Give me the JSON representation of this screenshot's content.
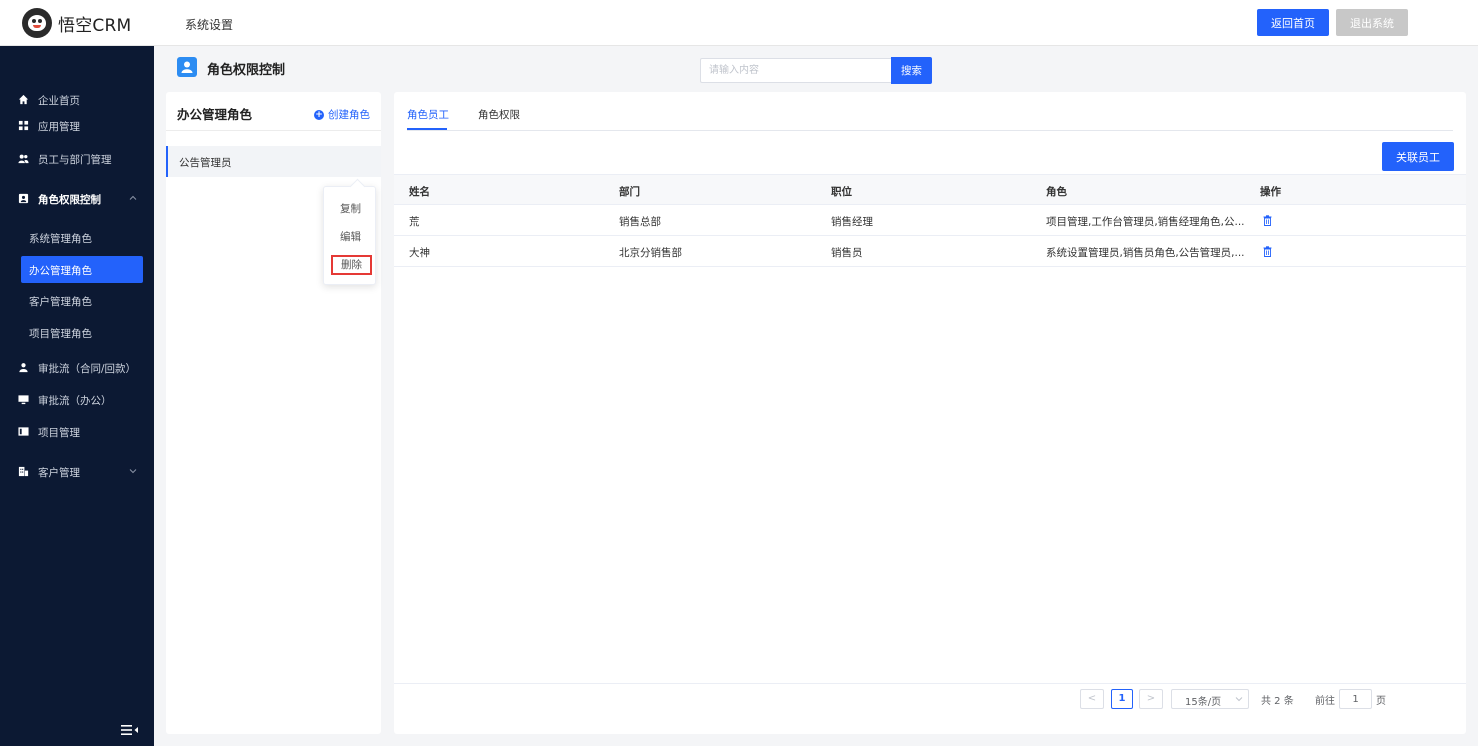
{
  "app": {
    "logo_text": "悟空CRM",
    "section_title": "系统设置"
  },
  "header": {
    "home_label": "返回首页",
    "exit_label": "退出系统"
  },
  "sidebar": {
    "items": [
      {
        "label": "企业首页",
        "icon": "home-icon"
      },
      {
        "label": "应用管理",
        "icon": "apps-icon"
      },
      {
        "label": "员工与部门管理",
        "icon": "users-icon"
      },
      {
        "label": "角色权限控制",
        "icon": "role-icon",
        "expanded": true
      },
      {
        "label": "审批流（合同/回款）",
        "icon": "approval-icon"
      },
      {
        "label": "审批流（办公）",
        "icon": "monitor-icon"
      },
      {
        "label": "项目管理",
        "icon": "project-icon"
      },
      {
        "label": "客户管理",
        "icon": "customer-icon",
        "expandable": true
      }
    ],
    "sub_items": [
      {
        "label": "系统管理角色",
        "active": false
      },
      {
        "label": "办公管理角色",
        "active": true
      },
      {
        "label": "客户管理角色",
        "active": false
      },
      {
        "label": "项目管理角色",
        "active": false
      }
    ]
  },
  "page": {
    "title": "角色权限控制"
  },
  "search": {
    "placeholder": "请输入内容",
    "value": "",
    "button_label": "搜索"
  },
  "role_panel": {
    "title": "办公管理角色",
    "create_label": "创建角色",
    "roles": [
      {
        "label": "公告管理员"
      }
    ]
  },
  "popover": {
    "copy": "复制",
    "edit": "编辑",
    "delete": "删除"
  },
  "tabs": [
    {
      "label": "角色员工",
      "active": true
    },
    {
      "label": "角色权限",
      "active": false
    }
  ],
  "link_button": "关联员工",
  "table": {
    "headers": {
      "name": "姓名",
      "dept": "部门",
      "position": "职位",
      "role": "角色",
      "action": "操作"
    },
    "rows": [
      {
        "name": "荒",
        "dept": "销售总部",
        "position": "销售经理",
        "role": "项目管理,工作台管理员,销售经理角色,公..."
      },
      {
        "name": "大神",
        "dept": "北京分销售部",
        "position": "销售员",
        "role": "系统设置管理员,销售员角色,公告管理员,..."
      }
    ]
  },
  "pagination": {
    "prev": "<",
    "current_page": "1",
    "next": ">",
    "page_size": "15条/页",
    "total": "共 2 条",
    "goto_label": "前往",
    "goto_value": "1",
    "page_unit": "页"
  },
  "colors": {
    "primary": "#2362fb",
    "sidebar_bg": "#0c1933",
    "danger": "#e53935"
  }
}
